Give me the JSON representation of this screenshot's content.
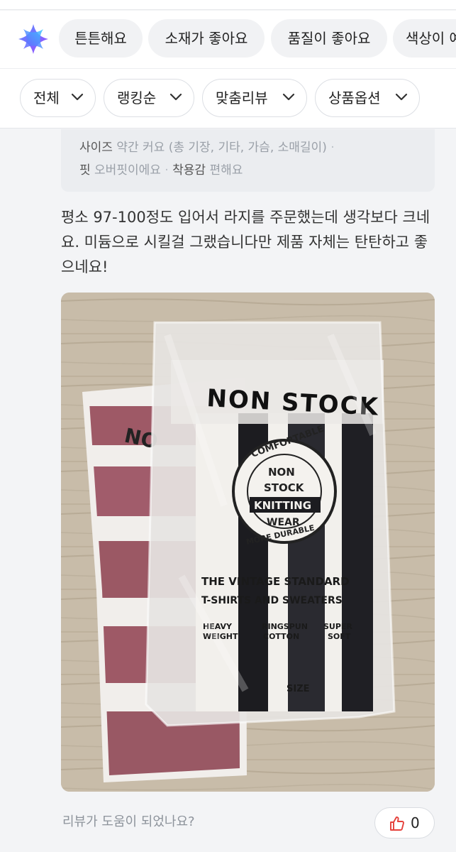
{
  "keyword_chips": [
    {
      "label": "튼튼해요"
    },
    {
      "label": "소재가 좋아요"
    },
    {
      "label": "품질이 좋아요"
    },
    {
      "label": "색상이 예"
    }
  ],
  "filters": [
    {
      "label": "전체"
    },
    {
      "label": "랭킹순"
    },
    {
      "label": "맞춤리뷰"
    },
    {
      "label": "상품옵션"
    }
  ],
  "review": {
    "specs": {
      "size_key": "사이즈",
      "size_val": "약간 커요 (총 기장, 기타, 가슴, 소매길이)",
      "fit_key": "핏",
      "fit_val": "오버핏이에요",
      "comfort_key": "착용감",
      "comfort_val": "편해요"
    },
    "text": "평소 97-100정도 입어서 라지를 주문했는데 생각보다 크네요. 미듐으로 시킬걸 그랬습니다만 제품 자체는 탄탄하고 좋으네요!",
    "photo": {
      "brand_text": "NON STOCK",
      "back_brand": "NO",
      "seal_top": "COMFORTABLE",
      "seal_mid1": "NON",
      "seal_mid2": "STOCK",
      "seal_mid3": "KNITTING",
      "seal_mid4": "WEAR",
      "seal_bottom": "MORE DURABLE",
      "line1": "THE VINTAGE STANDARD",
      "line2": "T-SHIRTS AND SWEATERS",
      "feat1a": "HEAVY",
      "feat1b": "WEIGHT",
      "feat2a": "RINGSPUN",
      "feat2b": "COTTON",
      "feat3a": "SUPER",
      "feat3b": "SOFT",
      "size_label": "SIZE"
    },
    "helpful_question": "리뷰가 도움이 되었나요?",
    "like_count": "0"
  },
  "colors": {
    "accent_blue": "#3d6bff",
    "accent_purple": "#9b5cff",
    "like_red": "#e5413b",
    "burgundy": "#7e2233"
  },
  "icons": {
    "ai_icon": "sparkle-star-icon",
    "chevron": "chevron-down-icon",
    "like": "thumbs-up-icon"
  }
}
